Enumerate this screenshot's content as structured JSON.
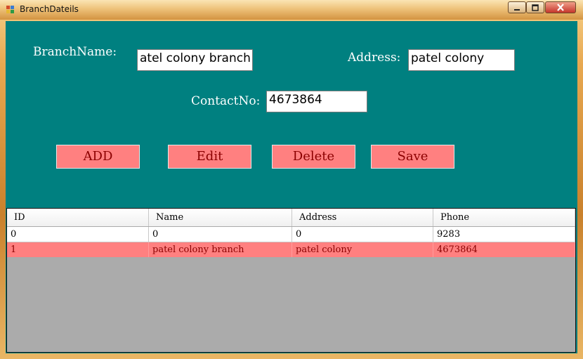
{
  "window": {
    "title": "BranchDateils",
    "controls": {
      "minimize": "minimize-icon",
      "maximize": "maximize-icon",
      "close": "close-icon"
    }
  },
  "form": {
    "branch_name_label": "BranchName:",
    "branch_name_value": "atel colony branch",
    "address_label": "Address:",
    "address_value": "patel colony",
    "contact_label": "ContactNo:",
    "contact_value": "4673864"
  },
  "buttons": {
    "add": "ADD",
    "edit": "Edit",
    "delete": "Delete",
    "save": "Save"
  },
  "grid": {
    "columns": [
      "ID",
      "Name",
      "Address",
      "Phone"
    ],
    "rows": [
      [
        "0",
        "0",
        "0",
        "9283"
      ],
      [
        "1",
        "patel colony branch",
        "patel colony",
        "4673864"
      ]
    ],
    "selected_row": 1
  },
  "colors": {
    "client_bg": "#008080",
    "button_bg": "#ff8080",
    "button_text": "#8b0000",
    "selected_row_bg": "#ff8080",
    "grid_bg": "#ababab"
  }
}
